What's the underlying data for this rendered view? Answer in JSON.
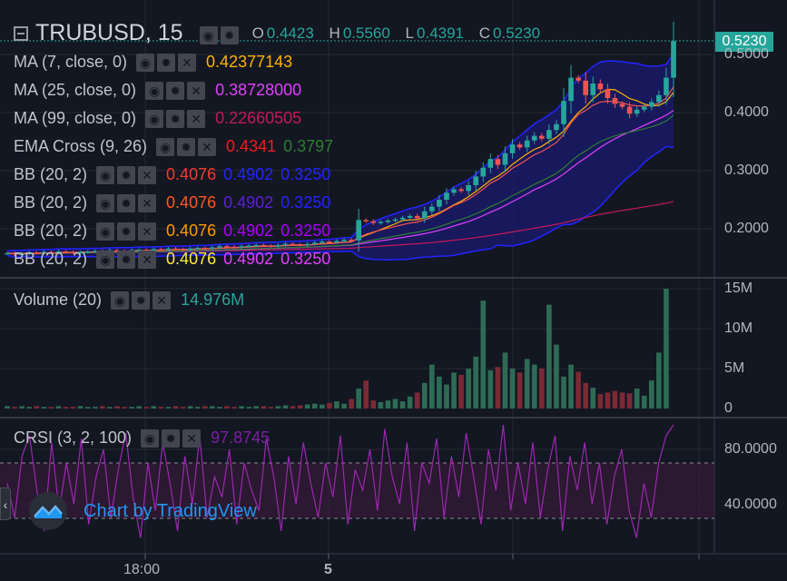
{
  "symbol": {
    "name": "TRUBUSD",
    "interval": "15"
  },
  "ohlc": [
    {
      "k": "O",
      "v": "0.4423"
    },
    {
      "k": "H",
      "v": "0.5560"
    },
    {
      "k": "L",
      "v": "0.4391"
    },
    {
      "k": "C",
      "v": "0.5230"
    }
  ],
  "last_price_tag": "0.5230",
  "indicators": [
    {
      "name": "MA (7, close, 0)",
      "values": [
        {
          "text": "0.42377143",
          "color": "#ffb300"
        }
      ]
    },
    {
      "name": "MA (25, close, 0)",
      "values": [
        {
          "text": "0.38728000",
          "color": "#e040fb"
        }
      ]
    },
    {
      "name": "MA (99, close, 0)",
      "values": [
        {
          "text": "0.22660505",
          "color": "#c2185b"
        }
      ]
    },
    {
      "name": "EMA Cross (9, 26)",
      "values": [
        {
          "text": "0.4341",
          "color": "#ef1c1c"
        },
        {
          "text": "0.3797",
          "color": "#2e7d32"
        }
      ]
    },
    {
      "name": "BB (20, 2)",
      "values": [
        {
          "text": "0.4076",
          "color": "#f23b2e"
        },
        {
          "text": "0.4902",
          "color": "#2323ff"
        },
        {
          "text": "0.3250",
          "color": "#2323ff"
        }
      ]
    },
    {
      "name": "BB (20, 2)",
      "values": [
        {
          "text": "0.4076",
          "color": "#ff5722"
        },
        {
          "text": "0.4902",
          "color": "#5c1fd6"
        },
        {
          "text": "0.3250",
          "color": "#2323ff"
        }
      ]
    },
    {
      "name": "BB (20, 2)",
      "values": [
        {
          "text": "0.4076",
          "color": "#ff9800"
        },
        {
          "text": "0.4902",
          "color": "#aa00ff"
        },
        {
          "text": "0.3250",
          "color": "#aa00ff"
        }
      ]
    },
    {
      "name": "BB (20, 2)",
      "values": [
        {
          "text": "0.4076",
          "color": "#ffeb3b"
        },
        {
          "text": "0.4902",
          "color": "#e040fb"
        },
        {
          "text": "0.3250",
          "color": "#e040fb"
        }
      ]
    }
  ],
  "volume_pane": {
    "name": "Volume (20)",
    "value": "14.976M",
    "axis": [
      "15M",
      "10M",
      "5M",
      "0"
    ]
  },
  "crsi_pane": {
    "name": "CRSI (3, 2, 100)",
    "value": "97.8745",
    "axis": [
      "80.0000",
      "40.0000"
    ]
  },
  "price_axis": [
    "0.5000",
    "0.4000",
    "0.3000",
    "0.2000"
  ],
  "time_axis": [
    "18:00",
    "5"
  ],
  "watermark": "Chart by TradingView",
  "icons": {
    "visibility": "eye-icon",
    "settings": "gear-icon",
    "remove": "close-icon",
    "collapse": "collapse-icon",
    "logo": "tradingview-logo-icon"
  },
  "colors": {
    "up": "#26a69a",
    "down": "#ef5350",
    "background": "#131722",
    "bb_fill": "#1a1a66"
  },
  "chart_data": {
    "type": "candlestick",
    "ylim": [
      0.13,
      0.56
    ],
    "closes": [
      0.158,
      0.156,
      0.157,
      0.159,
      0.158,
      0.16,
      0.159,
      0.161,
      0.16,
      0.159,
      0.16,
      0.161,
      0.162,
      0.161,
      0.163,
      0.162,
      0.161,
      0.163,
      0.164,
      0.163,
      0.165,
      0.164,
      0.166,
      0.165,
      0.164,
      0.166,
      0.167,
      0.166,
      0.168,
      0.17,
      0.169,
      0.168,
      0.17,
      0.171,
      0.172,
      0.171,
      0.17,
      0.172,
      0.174,
      0.173,
      0.172,
      0.174,
      0.176,
      0.178,
      0.177,
      0.179,
      0.181,
      0.18,
      0.215,
      0.213,
      0.21,
      0.212,
      0.214,
      0.216,
      0.219,
      0.222,
      0.218,
      0.23,
      0.238,
      0.25,
      0.262,
      0.268,
      0.265,
      0.275,
      0.29,
      0.305,
      0.32,
      0.31,
      0.33,
      0.345,
      0.34,
      0.352,
      0.36,
      0.355,
      0.37,
      0.38,
      0.42,
      0.46,
      0.455,
      0.43,
      0.45,
      0.44,
      0.425,
      0.415,
      0.41,
      0.398,
      0.405,
      0.41,
      0.418,
      0.43,
      0.46,
      0.523
    ],
    "volume_m": [
      0.3,
      0.2,
      0.3,
      0.2,
      0.3,
      0.2,
      0.2,
      0.3,
      0.2,
      0.2,
      0.3,
      0.2,
      0.2,
      0.3,
      0.2,
      0.3,
      0.2,
      0.2,
      0.3,
      0.2,
      0.3,
      0.2,
      0.2,
      0.3,
      0.2,
      0.3,
      0.2,
      0.3,
      0.3,
      0.2,
      0.3,
      0.2,
      0.3,
      0.2,
      0.3,
      0.3,
      0.2,
      0.3,
      0.4,
      0.3,
      0.4,
      0.5,
      0.6,
      0.5,
      0.7,
      0.9,
      0.6,
      1.2,
      2.5,
      3.5,
      1.0,
      0.8,
      1.0,
      1.2,
      0.9,
      1.5,
      2.0,
      3.2,
      5.5,
      4.0,
      3.0,
      4.5,
      4.2,
      5.0,
      6.5,
      13.5,
      4.8,
      5.2,
      7.0,
      5.0,
      4.5,
      6.2,
      5.5,
      5.0,
      13.0,
      8.0,
      4.0,
      5.5,
      4.6,
      3.2,
      2.6,
      1.8,
      2.0,
      2.2,
      2.0,
      1.9,
      2.5,
      1.6,
      3.5,
      7.0,
      15.0
    ],
    "crsi": [
      55,
      30,
      75,
      90,
      50,
      20,
      85,
      35,
      70,
      40,
      88,
      25,
      60,
      80,
      30,
      65,
      92,
      45,
      15,
      70,
      35,
      85,
      55,
      20,
      75,
      40,
      90,
      30,
      60,
      45,
      80,
      25,
      70,
      50,
      35,
      88,
      60,
      20,
      75,
      40,
      85,
      55,
      30,
      70,
      45,
      90,
      25,
      65,
      50,
      80,
      35,
      95,
      60,
      40,
      85,
      20,
      70,
      55,
      88,
      30,
      75,
      45,
      92,
      60,
      25,
      80,
      50,
      98,
      35,
      70,
      40,
      85,
      30,
      65,
      90,
      20,
      75,
      50,
      85,
      40,
      70,
      25,
      60,
      80,
      35,
      15,
      55,
      30,
      70,
      90,
      98
    ]
  }
}
